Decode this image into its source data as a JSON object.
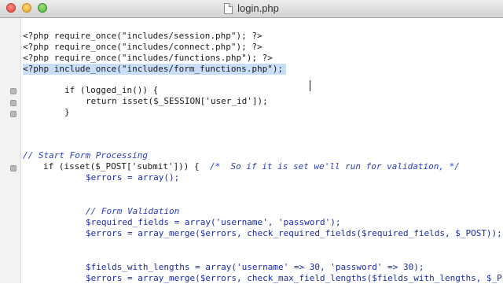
{
  "window": {
    "title": "login.php",
    "file_icon": "document-icon"
  },
  "colors": {
    "selection": "#c9defa",
    "gutter": "#f2f2f2",
    "keyword": "#1e2a8a",
    "comment": "#2a3fc0"
  },
  "code": {
    "lines": [
      "<?php require_once(\"includes/session.php\"); ?>",
      "<?php require_once(\"includes/connect.php\"); ?>",
      "<?php require_once(\"includes/functions.php\"); ?>",
      "<?php include_once(\"includes/form_functions.php\");",
      "if (logged_in()) {",
      "return isset($_SESSION['user_id']);",
      "}",
      "// Start Form Processing",
      "if (isset($_POST['submit'])) {",
      "/*  So if it is set we'll run for validation, */",
      "$errors = array();",
      "// Form Validation",
      "$required_fields = array('username', 'password');",
      "$errors = array_merge($errors, check_required_fields($required_fields, $_POST));",
      "$fields_with_lengths = array('username' => 30, 'password' => 30);",
      "$errors = array_merge($errors, check_max_field_lengths($fields_with_lengths, $_P"
    ]
  }
}
